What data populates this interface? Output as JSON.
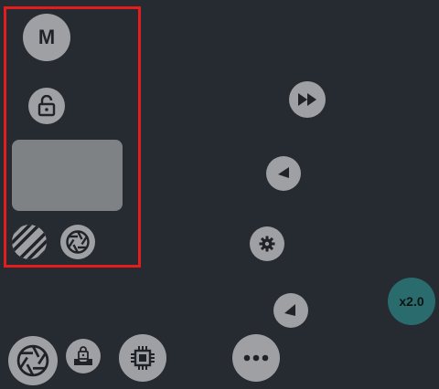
{
  "mode_button": {
    "label": "M"
  },
  "speed_button": {
    "label": "x2.0"
  },
  "colors": {
    "background": "#262a31",
    "button": "#9ea0a3",
    "panel": "#7f8285",
    "accent": "#2a6c6e",
    "selection": "#e31d1d"
  },
  "icons": [
    "lock-open-icon",
    "stripes-icon",
    "aperture-icon",
    "fast-forward-icon",
    "rewind-icon",
    "gear-icon",
    "lock-tray-icon",
    "chip-icon",
    "more-icon"
  ]
}
